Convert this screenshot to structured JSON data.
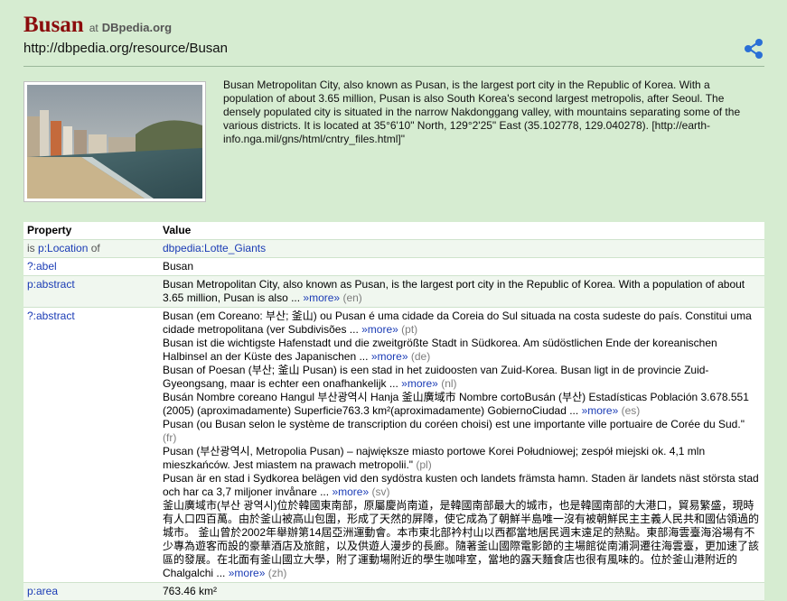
{
  "header": {
    "title": "Busan",
    "at_label": "at",
    "brand": "DBpedia.org",
    "uri": "http://dbpedia.org/resource/Busan"
  },
  "icons": {
    "share": "share-icon"
  },
  "colors": {
    "background": "#d6ecd1",
    "title": "#8b0c0c",
    "link": "#1a3bb5"
  },
  "summary": "Busan Metropolitan City, also known as Pusan, is the largest port city in the Republic of Korea. With a population of about 3.65 million, Pusan is also South Korea's second largest metropolis, after Seoul. The densely populated city is situated in the narrow Nakdonggang valley, with mountains separating some of the various districts. It is located at 35°6'10\" North, 129°2'25\" East (35.102778, 129.040278). [http://earth-info.nga.mil/gns/html/cntry_files.html]\"",
  "table": {
    "headers": {
      "property": "Property",
      "value": "Value"
    },
    "location": {
      "is": "is",
      "prefix": "p:",
      "name": "Location",
      "of": "of",
      "value": "dbpedia:Lotte_Giants"
    },
    "abel": {
      "property": "?:abel",
      "value": "Busan"
    },
    "abstract1": {
      "property": "p:abstract",
      "text": "Busan Metropolitan City, also known as Pusan, is the largest port city in the Republic of Korea. With a population of about 3.65 million, Pusan is also ...",
      "more": "»more»",
      "lang": "(en)"
    },
    "abstract2": {
      "property": "?:abstract",
      "entries": [
        {
          "text": "Busan (em Coreano: 부산; 釜山) ou Pusan é uma cidade da Coreia do Sul situada na costa sudeste do país. Constitui uma cidade metropolitana (ver Subdivisões ...",
          "more": "»more»",
          "lang": "(pt)"
        },
        {
          "text": "Busan ist die wichtigste Hafenstadt und die zweitgrößte Stadt in Südkorea. Am südöstlichen Ende der koreanischen Halbinsel an der Küste des Japanischen ...",
          "more": "»more»",
          "lang": "(de)"
        },
        {
          "text": "Busan of Poesan (부산; 釜山 Pusan) is een stad in het zuidoosten van Zuid-Korea. Busan ligt in de provincie Zuid-Gyeongsang, maar is echter een onafhankelijk ...",
          "more": "»more»",
          "lang": "(nl)"
        },
        {
          "text": "Busán Nombre coreano Hangul 부산광역시 Hanja 釜山廣域市 Nombre cortoBusán (부산) Estadísticas Población 3.678.551 (2005) (aproximadamente) Superficie763.3 km²(aproximadamente) GobiernoCiudad ...",
          "more": "»more»",
          "lang": "(es)"
        },
        {
          "text": "Pusan (ou Busan selon le système de transcription du coréen choisi) est une importante ville portuaire de Corée du Sud.\"",
          "more": "",
          "lang": "(fr)"
        },
        {
          "text": "Pusan (부산광역시, Metropolia Pusan) – największe miasto portowe Korei Południowej; zespół miejski ok. 4,1 mln mieszkańców. Jest miastem na prawach metropolii.\"",
          "more": "",
          "lang": "(pl)"
        },
        {
          "text": "Pusan är en stad i Sydkorea belägen vid den sydöstra kusten och landets främsta hamn. Staden är landets näst största stad och har ca 3,7 miljoner invånare ...",
          "more": "»more»",
          "lang": "(sv)"
        },
        {
          "text": "釜山廣域市(부산 광역시)位於韓國東南部，原屬慶尚南道，是韓國南部最大的城市，也是韓國南部的大港口，貿易繁盛，現時有人口四百萬。由於釜山被高山包圍，形成了天然的屏障，使它成為了朝鮮半島唯一沒有被朝鮮民主主義人民共和國佔領過的城市。 釜山曾於2002年舉辦第14屆亞洲運動會。本市東北部衿村山以西都當地居民週末遠足的熱點。東部海雲臺海浴場有不少專為遊客而設的豪華酒店及旅館，以及供遊人漫步的長廊。隨著釜山國際電影節的主場館從南浦洞遷往海雲臺，更加速了該區的發展。在北面有釜山國立大學，附了運動場附近的學生咖啡室，當地的露天麵食店也很有風味的。位於釜山港附近的Chalgalchi ...",
          "more": "»more»",
          "lang": "(zh)"
        }
      ]
    },
    "area": {
      "property": "p:area",
      "value": "763.46 km²"
    }
  }
}
